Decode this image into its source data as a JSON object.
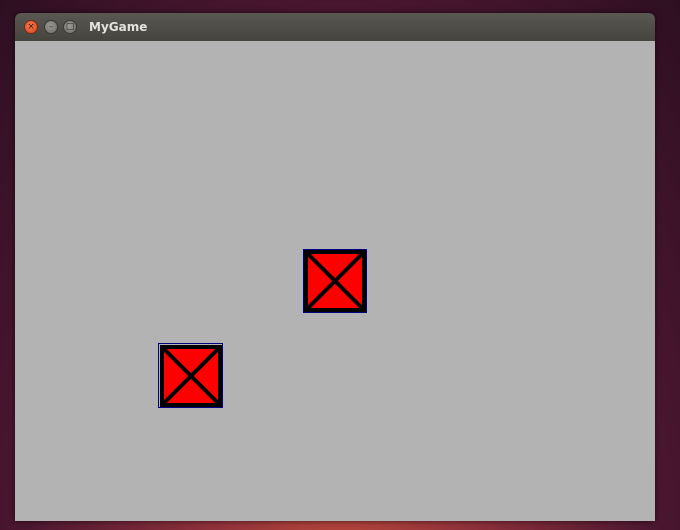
{
  "window": {
    "title": "MyGame",
    "controls": {
      "close_icon": "close-icon",
      "minimize_icon": "minimize-icon",
      "maximize_icon": "maximize-icon",
      "close_glyph": "×",
      "minimize_glyph": "–",
      "maximize_glyph": "□"
    }
  },
  "canvas": {
    "background": "#b3b3b3",
    "sprites": [
      {
        "fill": "#ff0000",
        "stroke": "#000000",
        "outline": "#000080"
      },
      {
        "fill": "#ff0000",
        "stroke": "#000000",
        "outline": "#000080"
      }
    ]
  }
}
